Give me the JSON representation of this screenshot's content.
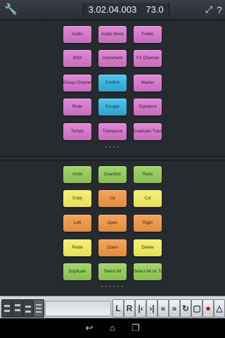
{
  "topbar": {
    "position": "3.02.04.003",
    "tempo": "73.0",
    "wrench_icon": "wrench-icon",
    "expand_icon": "expand-icon",
    "help_icon": "help-icon"
  },
  "top_panel": {
    "rows": [
      [
        {
          "label": "Audio",
          "color": "pink"
        },
        {
          "label": "Audio Mono",
          "color": "pink"
        },
        {
          "label": "Folder",
          "color": "pink"
        }
      ],
      [
        {
          "label": "MIDI",
          "color": "pink"
        },
        {
          "label": "Instrument",
          "color": "pink"
        },
        {
          "label": "FX Channel",
          "color": "pink"
        }
      ],
      [
        {
          "label": "Group Channel",
          "color": "pink"
        },
        {
          "label": "Confirm",
          "color": "blue"
        },
        {
          "label": "Marker",
          "color": "pink"
        }
      ],
      [
        {
          "label": "Ruler",
          "color": "pink"
        },
        {
          "label": "Escape",
          "color": "blue"
        },
        {
          "label": "Signature",
          "color": "pink"
        }
      ],
      [
        {
          "label": "Tempo",
          "color": "pink"
        },
        {
          "label": "Transpose",
          "color": "pink"
        },
        {
          "label": "Duplicate Tracks",
          "color": "pink"
        }
      ]
    ],
    "page_indicator": "• • • •"
  },
  "bottom_panel": {
    "rows": [
      [
        {
          "label": "Undo",
          "color": "green"
        },
        {
          "label": "Quantize",
          "color": "green"
        },
        {
          "label": "Redo",
          "color": "green"
        }
      ],
      [
        {
          "label": "Copy",
          "color": "yellow"
        },
        {
          "label": "Up",
          "color": "orange"
        },
        {
          "label": "Cut",
          "color": "yellow"
        }
      ],
      [
        {
          "label": "Left",
          "color": "orange"
        },
        {
          "label": "Open",
          "color": "orange"
        },
        {
          "label": "Right",
          "color": "orange"
        }
      ],
      [
        {
          "label": "Paste",
          "color": "yellow"
        },
        {
          "label": "Down",
          "color": "orange"
        },
        {
          "label": "Delete",
          "color": "yellow"
        }
      ],
      [
        {
          "label": "Duplicate",
          "color": "green"
        },
        {
          "label": "Select All",
          "color": "green"
        },
        {
          "label": "Select All on Tracks",
          "color": "green"
        }
      ]
    ],
    "page_indicator": "• • • • • •"
  },
  "transport": {
    "buttons": [
      "L",
      "R",
      "⏮",
      "⏭",
      "⏪",
      "⏩",
      "↺",
      "●",
      "♫"
    ],
    "rewind_label": "«",
    "ffwd_label": "»"
  },
  "navbar": {
    "back_icon": "back-icon",
    "home_icon": "home-icon",
    "recents_icon": "recents-icon"
  }
}
